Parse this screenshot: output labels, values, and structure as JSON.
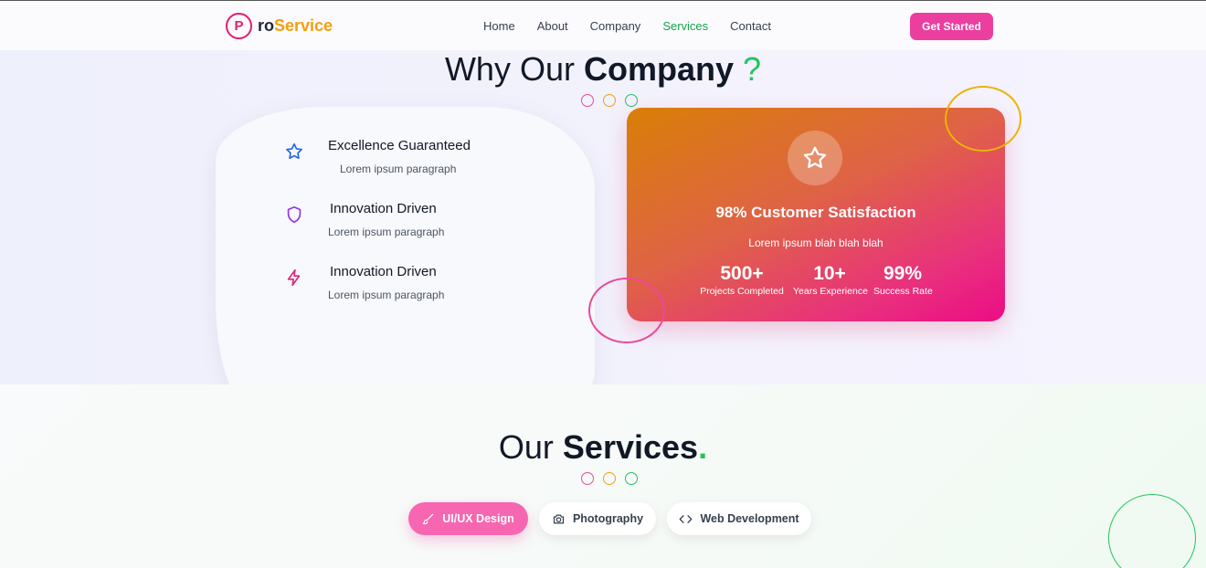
{
  "brand": {
    "mark": "P",
    "text_a": "ro",
    "text_b": "Service"
  },
  "nav": {
    "items": [
      {
        "label": "Home",
        "active": false
      },
      {
        "label": "About",
        "active": false
      },
      {
        "label": "Company",
        "active": false
      },
      {
        "label": "Services",
        "active": true
      },
      {
        "label": "Contact",
        "active": false
      }
    ],
    "cta": "Get Started"
  },
  "why": {
    "title_light": "Why Our ",
    "title_bold": "Company",
    "title_mark": " ?",
    "features": [
      {
        "title": "Excellence Guaranteed",
        "desc": "Lorem ipsum paragraph",
        "icon": "star-icon"
      },
      {
        "title": "Innovation Driven",
        "desc": "Lorem ipsum paragraph",
        "icon": "shield-icon"
      },
      {
        "title": "Innovation Driven",
        "desc": "Lorem ipsum paragraph",
        "icon": "lightning-icon"
      }
    ],
    "card": {
      "icon": "star-icon",
      "title": "98% Customer Satisfaction",
      "subtitle": "Lorem ipsum blah blah blah",
      "stats": [
        {
          "value": "500+",
          "label": "Projects Completed"
        },
        {
          "value": "10+",
          "label": "Years Experience"
        },
        {
          "value": "99%",
          "label": "Success Rate"
        }
      ]
    }
  },
  "services": {
    "title_light": "Our ",
    "title_bold": "Services",
    "title_mark": ".",
    "tabs": [
      {
        "label": "UI/UX Design",
        "icon": "brush-icon",
        "active": true
      },
      {
        "label": "Photography",
        "icon": "camera-icon",
        "active": false
      },
      {
        "label": "Web Development",
        "icon": "code-icon",
        "active": false
      }
    ]
  },
  "colors": {
    "pink": "#e11d74",
    "amber": "#f59e0b",
    "green": "#22c55e",
    "cta": "#ec3e9f"
  }
}
